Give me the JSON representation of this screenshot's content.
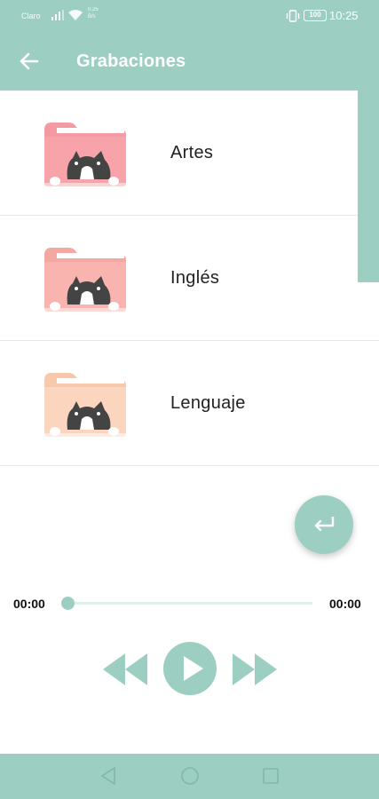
{
  "status_bar": {
    "carrier": "Claro",
    "speed_value": "0.25",
    "speed_unit": "B/s",
    "battery": "100",
    "time": "10:25"
  },
  "app_bar": {
    "title": "Grabaciones",
    "back_icon": "arrow-left-icon"
  },
  "folders": [
    {
      "label": "Artes",
      "color": "#f7a3a9"
    },
    {
      "label": "Inglés",
      "color": "#f9b4b0"
    },
    {
      "label": "Lenguaje",
      "color": "#fcd5bf"
    }
  ],
  "fab": {
    "icon": "return-arrow-icon"
  },
  "player": {
    "current_time": "00:00",
    "total_time": "00:00",
    "progress": 0,
    "controls": [
      "rewind-icon",
      "play-icon",
      "fast-forward-icon"
    ]
  },
  "nav_bar": {
    "icons": [
      "nav-back-icon",
      "nav-home-icon",
      "nav-recent-icon"
    ]
  },
  "colors": {
    "accent": "#9ccfc2",
    "track": "#dcefe9"
  }
}
